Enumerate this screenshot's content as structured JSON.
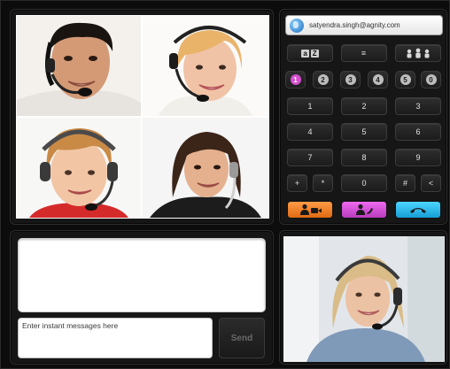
{
  "contact": {
    "email": "satyendra.singh@agnity.com",
    "icon": "globe-icon"
  },
  "dial_modes": [
    {
      "name": "contacts-az",
      "glyph_left": "a",
      "glyph_right": "Z"
    },
    {
      "name": "call-list",
      "glyph": "≡"
    },
    {
      "name": "conference",
      "glyph": "conference-icon"
    }
  ],
  "lines": {
    "labels": [
      "1",
      "2",
      "3",
      "4",
      "5",
      "0"
    ],
    "active_index": 0,
    "active_color": "#d64fd0"
  },
  "keypad": {
    "rows": [
      [
        "1",
        "2",
        "3"
      ],
      [
        "4",
        "5",
        "6"
      ],
      [
        "7",
        "8",
        "9"
      ]
    ],
    "bottom": [
      "+",
      "*",
      "0",
      "#",
      "<"
    ]
  },
  "call_buttons": {
    "video": {
      "icon": "video-call-icon",
      "color": "#f07a22"
    },
    "audio": {
      "icon": "audio-call-icon",
      "color": "#d44fd6"
    },
    "hangup": {
      "icon": "hang-up-icon",
      "color": "#22aee6"
    }
  },
  "chat": {
    "placeholder": "Enter instant messages here",
    "send_label": "Send"
  },
  "video_tiles": [
    {
      "name": "participant-1"
    },
    {
      "name": "participant-2"
    },
    {
      "name": "participant-3"
    },
    {
      "name": "participant-4"
    }
  ],
  "self_view": {
    "name": "self-view"
  }
}
